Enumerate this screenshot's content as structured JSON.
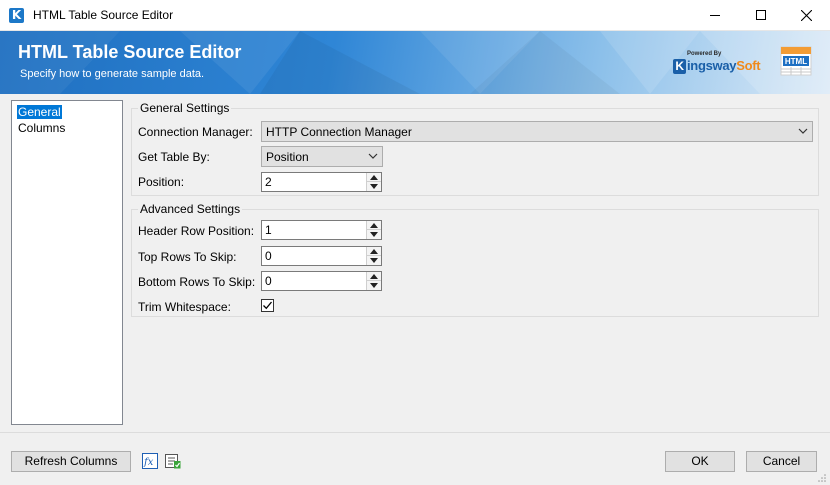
{
  "window": {
    "title": "HTML Table Source Editor",
    "app_icon_letter": "K"
  },
  "banner": {
    "title": "HTML Table Source Editor",
    "subtitle": "Specify how to generate sample data.",
    "brand_powered": "Powered By",
    "brand_name_1": "ingsway",
    "brand_name_2": "Soft",
    "brand_k": "K",
    "html_badge": "HTML"
  },
  "nav": {
    "items": [
      {
        "label": "General",
        "selected": true
      },
      {
        "label": "Columns",
        "selected": false
      }
    ]
  },
  "general_settings": {
    "title": "General Settings",
    "connection_manager_label": "Connection Manager:",
    "connection_manager_value": "HTTP Connection Manager",
    "get_table_by_label": "Get Table By:",
    "get_table_by_value": "Position",
    "position_label": "Position:",
    "position_value": "2"
  },
  "advanced_settings": {
    "title": "Advanced Settings",
    "header_row_label": "Header Row Position:",
    "header_row_value": "1",
    "top_rows_label": "Top Rows To Skip:",
    "top_rows_value": "0",
    "bottom_rows_label": "Bottom Rows To Skip:",
    "bottom_rows_value": "0",
    "trim_label": "Trim Whitespace:",
    "trim_checked": true
  },
  "footer": {
    "refresh_label": "Refresh Columns",
    "ok_label": "OK",
    "cancel_label": "Cancel"
  }
}
